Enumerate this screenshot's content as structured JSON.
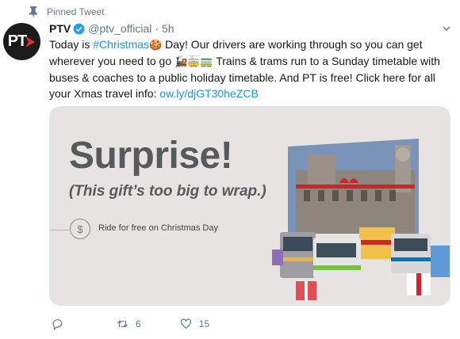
{
  "pinned": {
    "label": "Pinned Tweet"
  },
  "author": {
    "avatar_text": "PT",
    "name": "PTV",
    "handle": "@ptv_official",
    "separator": "·",
    "time": "5h"
  },
  "tweet": {
    "seg1": "Today is ",
    "hashtag": "#Christmas",
    "emoji_gingerbread": "🍪",
    "seg2": " Day! Our drivers are working through so you can get wherever you need to go ",
    "emoji_transport": "🚂🚋🚃",
    "seg3": " Trains & trams run to a Sunday timetable with buses & coaches to a public holiday timetable. And PT is free! Click here for all your Xmas travel info: ",
    "link": "ow.ly/djGT30heZCB"
  },
  "media": {
    "headline": "Surprise!",
    "subline": "(This gift’s too big to wrap.)",
    "coin_symbol": "$",
    "free_line": "Ride for free on Christmas Day"
  },
  "actions": {
    "reply_count": "",
    "retweet_count": "6",
    "like_count": "15"
  },
  "colors": {
    "link": "#1b95e0",
    "muted": "#657786",
    "verified": "#1da1f2",
    "brand_red": "#e4312b"
  }
}
